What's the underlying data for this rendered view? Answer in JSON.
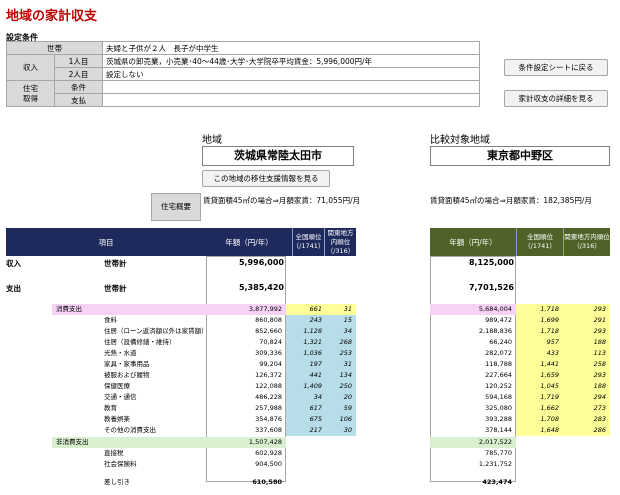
{
  "title": "地域の家計収支",
  "settings": {
    "heading": "設定条件",
    "rows": [
      {
        "label": "世帯",
        "sub": "",
        "value": "夫婦と子供が２人　長子が中学生"
      },
      {
        "label": "収入",
        "sub": "1人目",
        "value": "茨城県の卸売業，小売業･40～44歳･大学･大学院卒平均賃金：5,996,000円/年"
      },
      {
        "label": "",
        "sub": "2人目",
        "value": "設定しない"
      },
      {
        "label": "住宅取得",
        "sub": "条件",
        "value": ""
      },
      {
        "label": "",
        "sub": "支払",
        "value": ""
      }
    ],
    "label_income": "収入",
    "label_house": "住宅\n取得"
  },
  "buttons": {
    "back_to_settings": "条件設定シートに戻る",
    "view_details": "家計収支の詳細を見る",
    "migration_info": "この地域の移住支援情報を見る"
  },
  "region": {
    "label": "地域",
    "name": "茨城県常陸太田市",
    "rent_label": "住宅概要",
    "rent_text": "賃貸面積45㎡の場合⇒月額家賃：71,055円/月"
  },
  "compare": {
    "label": "比較対象地域",
    "name": "東京都中野区",
    "rent_text": "賃貸面積45㎡の場合⇒月額家賃：182,385円/月"
  },
  "table_header": {
    "item": "項目",
    "annual": "年額（円/年）",
    "national_rank": "全国順位（/1741）",
    "metro_rank": "関東地方内順位（/316）"
  },
  "income": {
    "label": "収入",
    "item": "世帯計",
    "value_a": "5,996,000",
    "value_b": "8,125,000"
  },
  "expense": {
    "label": "支出",
    "item": "世帯計",
    "value_a": "5,385,420",
    "value_b": "7,701,526"
  },
  "consumption": {
    "label": "消費支出",
    "value_a": "3,877,992",
    "nat_a": "661",
    "met_a": "31",
    "value_b": "5,684,004",
    "nat_b": "1,718",
    "met_b": "293"
  },
  "consumption_items": [
    {
      "label": "食料",
      "va": "860,808",
      "na": "243",
      "ma": "15",
      "vb": "989,472",
      "nb": "1,699",
      "mb": "291"
    },
    {
      "label": "住居（ローン返済額以外は家賃額）",
      "va": "852,660",
      "na": "1,128",
      "ma": "34",
      "vb": "2,188,836",
      "nb": "1,718",
      "mb": "293"
    },
    {
      "label": "住居（設備修繕・維持）",
      "va": "70,824",
      "na": "1,321",
      "ma": "268",
      "vb": "66,240",
      "nb": "957",
      "mb": "188"
    },
    {
      "label": "光熱・水道",
      "va": "309,336",
      "na": "1,036",
      "ma": "253",
      "vb": "282,072",
      "nb": "433",
      "mb": "113"
    },
    {
      "label": "家具・家事用品",
      "va": "99,204",
      "na": "197",
      "ma": "31",
      "vb": "118,788",
      "nb": "1,441",
      "mb": "258"
    },
    {
      "label": "被服および履物",
      "va": "126,372",
      "na": "441",
      "ma": "134",
      "vb": "227,664",
      "nb": "1,659",
      "mb": "293"
    },
    {
      "label": "保健医療",
      "va": "122,088",
      "na": "1,409",
      "ma": "250",
      "vb": "120,252",
      "nb": "1,045",
      "mb": "188"
    },
    {
      "label": "交通・通信",
      "va": "486,228",
      "na": "34",
      "ma": "20",
      "vb": "594,168",
      "nb": "1,719",
      "mb": "294"
    },
    {
      "label": "教育",
      "va": "257,988",
      "na": "617",
      "ma": "59",
      "vb": "325,080",
      "nb": "1,662",
      "mb": "273"
    },
    {
      "label": "教養娯楽",
      "va": "354,876",
      "na": "675",
      "ma": "106",
      "vb": "393,288",
      "nb": "1,708",
      "mb": "283"
    },
    {
      "label": "その他の消費支出",
      "va": "337,608",
      "na": "217",
      "ma": "30",
      "vb": "378,144",
      "nb": "1,648",
      "mb": "286"
    }
  ],
  "non_consumption": {
    "label": "非消費支出",
    "value_a": "1,507,428",
    "value_b": "2,017,522"
  },
  "non_consumption_items": [
    {
      "label": "直接税",
      "va": "602,928",
      "vb": "785,770"
    },
    {
      "label": "社会保険料",
      "va": "904,500",
      "vb": "1,231,752"
    }
  ],
  "balance": {
    "label": "差し引き",
    "value_a": "610,580",
    "value_b": "423,474"
  },
  "colors": {
    "title": "#c00000",
    "header_navy": "#1f2a5c",
    "header_olive": "#4f6228",
    "pink": "#f6d3f4",
    "green": "#d8f0cf",
    "blue_rank": "#b7dde8",
    "yellow_rank": "#ffff99"
  }
}
